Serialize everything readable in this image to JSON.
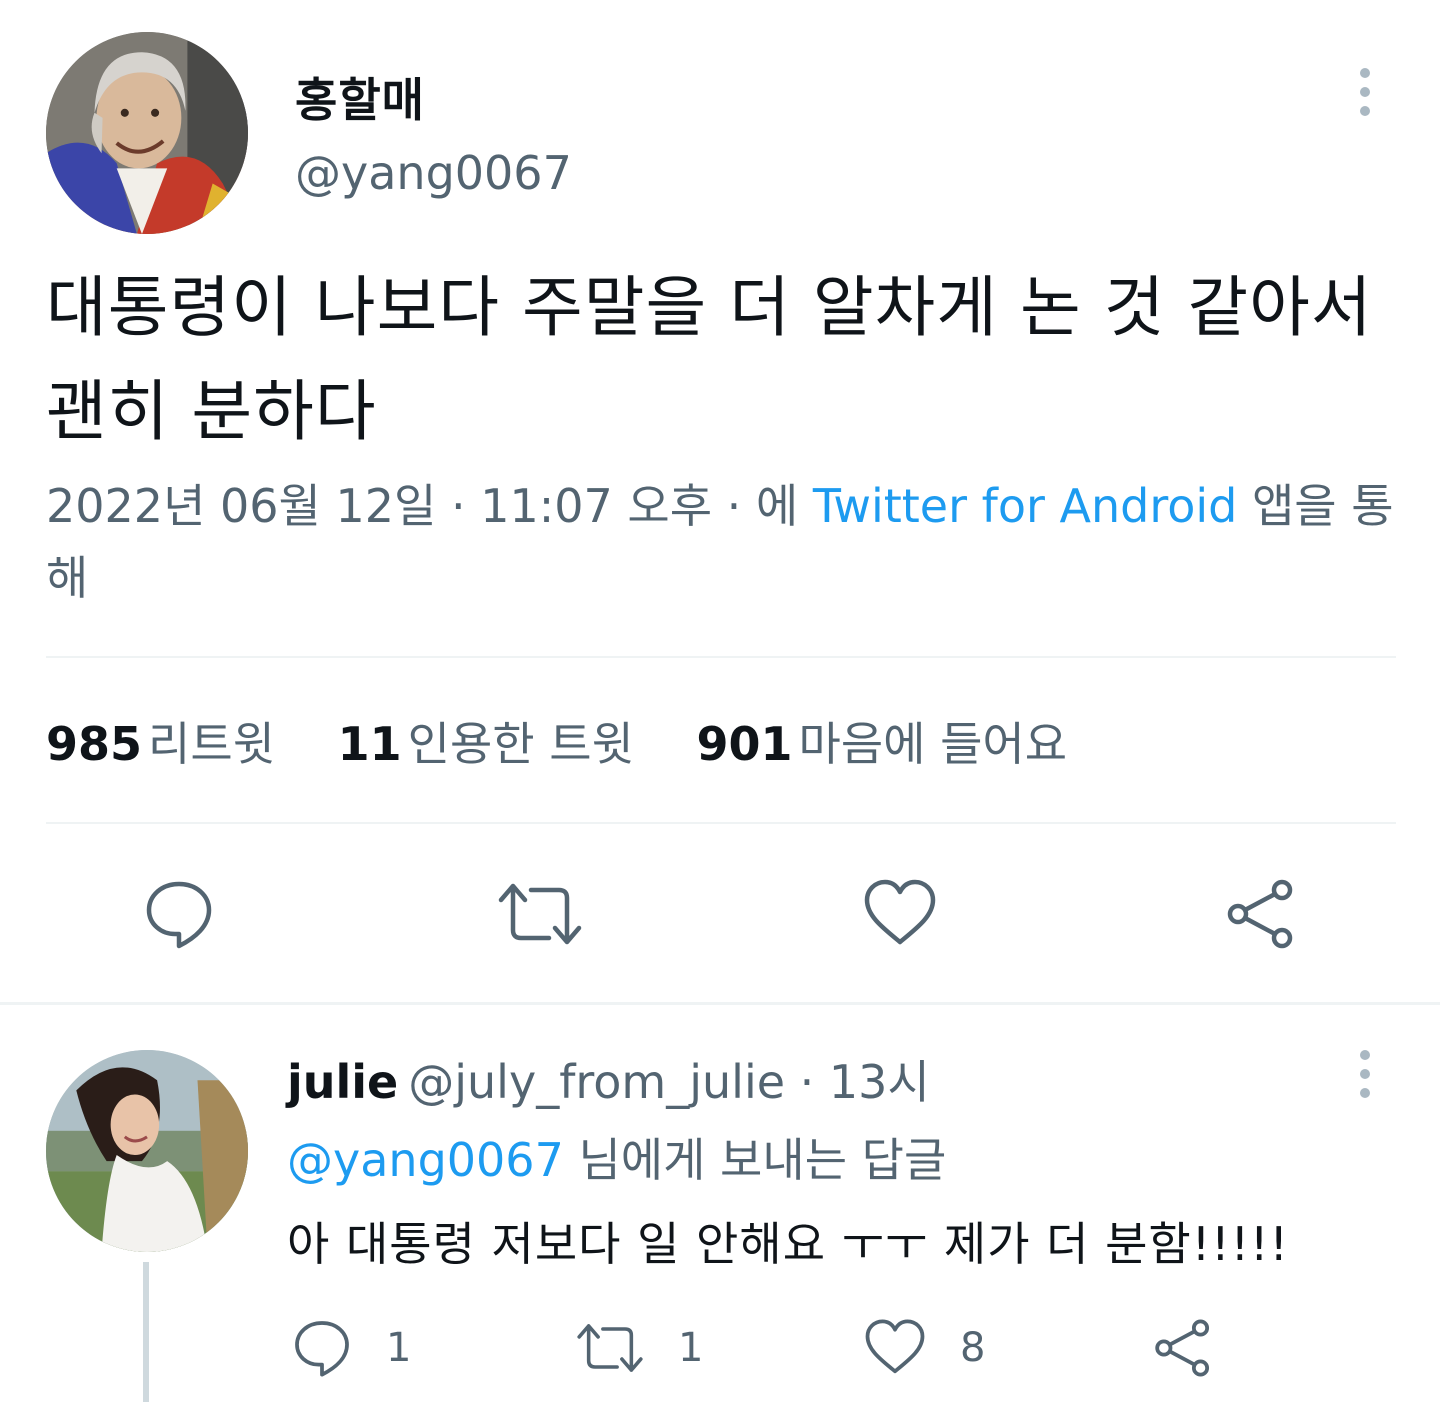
{
  "tweet": {
    "author_name": "홍할매",
    "author_handle": "@yang0067",
    "text": "대통령이 나보다 주말을 더 알차게 논 것 같아서 괜히 분하다",
    "timestamp": "2022년 06월 12일 · 11:07 오후 · 에 ",
    "source": "Twitter for Android",
    "source_suffix": " 앱을 통해",
    "stats": {
      "retweets": "985",
      "retweets_label": "리트윗",
      "quotes": "11",
      "quotes_label": "인용한 트윗",
      "likes": "901",
      "likes_label": "마음에 들어요"
    },
    "actions": [
      "reply-icon",
      "retweet-icon",
      "heart-icon",
      "share-icon"
    ]
  },
  "reply": {
    "name": "julie",
    "handle": "@july_from_julie",
    "time": " · 13시",
    "reply_to_mention": "@yang0067",
    "reply_to_suffix": " 님에게 보내는 답글",
    "text": "아 대통령 저보다 일 안해요 ㅜㅜ 제가 더 분함!!!!!",
    "counts": {
      "replies": "1",
      "retweets": "1",
      "likes": "8"
    }
  },
  "colors": {
    "accent": "#1d9bf0",
    "secondary_text": "#536471",
    "divider": "#eff3f4"
  }
}
